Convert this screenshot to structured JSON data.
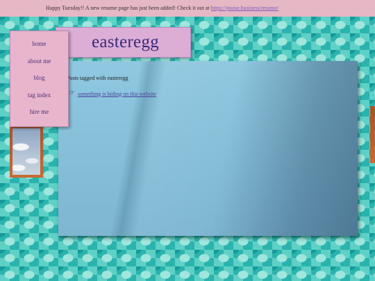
{
  "banner": {
    "message": "Happy Tuesday!! A new resume page has just been added! Check it out at",
    "link": "https://poose.business/resume/"
  },
  "header": {
    "title": "easteregg"
  },
  "nav": {
    "items": [
      {
        "label": "home"
      },
      {
        "label": "about me"
      },
      {
        "label": "blog"
      },
      {
        "label": "tag index"
      },
      {
        "label": "hire me"
      }
    ]
  },
  "content": {
    "tagged_heading": "Posts tagged with easteregg",
    "posts": [
      {
        "icon": "pointing-hand-icon",
        "title": "something is hiding on this website"
      }
    ]
  },
  "colors": {
    "banner_bg": "#e6b7c5",
    "nav_bg": "#e8b5cc",
    "header_bg": "#dcaed6",
    "title_color": "#3a2b7a",
    "link_color": "#4a3f9a"
  }
}
